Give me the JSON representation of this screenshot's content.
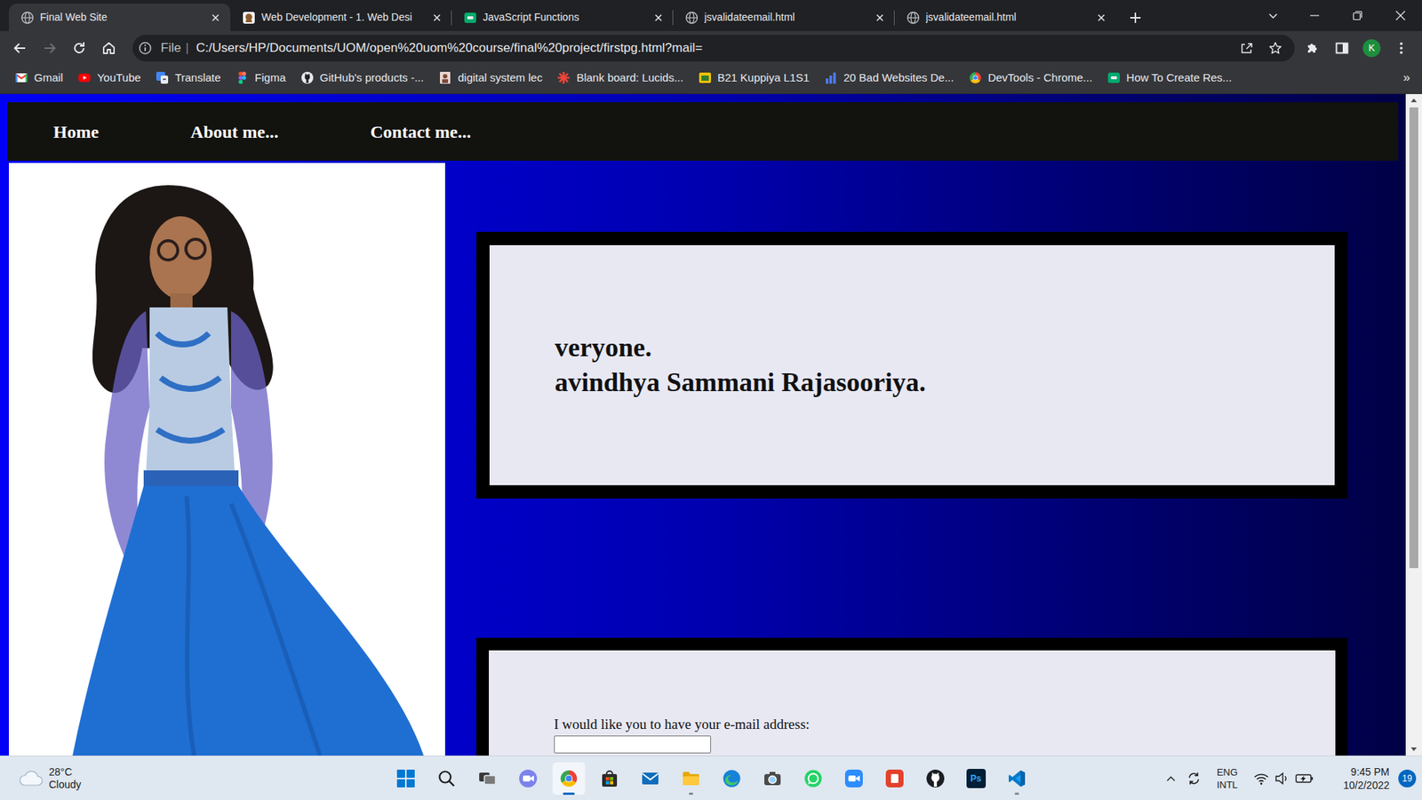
{
  "tabs": [
    {
      "label": "Final Web Site",
      "selected": true,
      "kind": "globe"
    },
    {
      "label": "Web Development - 1. Web Desi",
      "selected": false,
      "kind": "course"
    },
    {
      "label": "JavaScript Functions",
      "selected": false,
      "kind": "w3"
    },
    {
      "label": "jsvalidateemail.html",
      "selected": false,
      "kind": "globe"
    },
    {
      "label": "jsvalidateemail.html",
      "selected": false,
      "kind": "globe"
    }
  ],
  "toolbar": {
    "forward_disabled": true,
    "scheme": "File",
    "separator": "|",
    "url": "C:/Users/HP/Documents/UOM/open%20uom%20course/final%20project/firstpg.html?mail=",
    "profile": "K"
  },
  "bookmarks": [
    {
      "label": "Gmail",
      "kind": "gmail"
    },
    {
      "label": "YouTube",
      "kind": "youtube"
    },
    {
      "label": "Translate",
      "kind": "translate"
    },
    {
      "label": "Figma",
      "kind": "figma"
    },
    {
      "label": "GitHub's products -...",
      "kind": "github"
    },
    {
      "label": "digital system lec",
      "kind": "doc"
    },
    {
      "label": "Blank board: Lucids...",
      "kind": "lucid"
    },
    {
      "label": "B21 Kuppiya L1S1",
      "kind": "kuppiya"
    },
    {
      "label": "20 Bad Websites De...",
      "kind": "chart"
    },
    {
      "label": "DevTools - Chrome...",
      "kind": "chrome"
    },
    {
      "label": "How To Create Res...",
      "kind": "w3"
    }
  ],
  "bookmarks_more": "»",
  "page": {
    "nav": [
      "Home",
      "About me...",
      "Contact me..."
    ],
    "intro_lines": [
      "veryone.",
      "avindhya Sammani Rajasooriya."
    ],
    "email_label": "I would like you to have your e-mail address:",
    "email_value": ""
  },
  "taskbar": {
    "weather": {
      "temp": "28°C",
      "condition": "Cloudy"
    },
    "apps": [
      {
        "kind": "start",
        "running": false,
        "selected": false
      },
      {
        "kind": "search",
        "running": false,
        "selected": false
      },
      {
        "kind": "taskview",
        "running": false,
        "selected": false
      },
      {
        "kind": "chat",
        "running": false,
        "selected": false
      },
      {
        "kind": "chrome",
        "running": true,
        "selected": true
      },
      {
        "kind": "store",
        "running": false,
        "selected": false
      },
      {
        "kind": "mail",
        "running": false,
        "selected": false
      },
      {
        "kind": "explorer",
        "running": true,
        "selected": false
      },
      {
        "kind": "edge",
        "running": false,
        "selected": false
      },
      {
        "kind": "camera",
        "running": false,
        "selected": false
      },
      {
        "kind": "whatsapp",
        "running": false,
        "selected": false
      },
      {
        "kind": "zoom",
        "running": false,
        "selected": false
      },
      {
        "kind": "office",
        "running": false,
        "selected": false
      },
      {
        "kind": "github",
        "running": false,
        "selected": false
      },
      {
        "kind": "photoshop",
        "running": false,
        "selected": false,
        "glyph": "Ps"
      },
      {
        "kind": "vscode",
        "running": true,
        "selected": false
      }
    ],
    "language": [
      "ENG",
      "INTL"
    ],
    "time": "9:45 PM",
    "date": "10/2/2022",
    "notifications": "19"
  }
}
